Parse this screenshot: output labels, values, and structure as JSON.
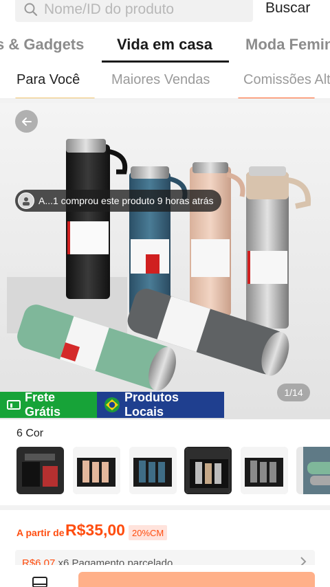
{
  "search": {
    "placeholder": "Nome/ID do produto",
    "button_label": "Buscar"
  },
  "category_tabs": [
    {
      "label": "s & Gadgets",
      "active": false
    },
    {
      "label": "Vida em casa",
      "active": true
    },
    {
      "label": "Moda Femin",
      "active": false
    }
  ],
  "sub_tabs": [
    {
      "label": "Para Você",
      "active": false
    },
    {
      "label": "Maiores Vendas",
      "active": false
    },
    {
      "label": "Comissões Alt",
      "active": true
    }
  ],
  "product": {
    "buyer_notice": "A...1 comprou este produto 9 horas atrás",
    "image_counter": "1/14",
    "badges": {
      "free_shipping": "Frete Grátis",
      "local_products": "Produtos Locais"
    },
    "color_count_label": "6 Cor",
    "price_prefix": "A partir de",
    "price": "R$35,00",
    "commission": "20%CM",
    "installment": {
      "price": "R$6,07",
      "text": "x6 Pagamento parcelado"
    }
  },
  "colors": {
    "accent": "#ff4d0f",
    "free_shipping_green": "#17a338",
    "local_blue": "#1f3f8f",
    "buy_button": "#ffb089"
  },
  "icons": [
    "search-icon",
    "back-arrow-icon",
    "truck-icon",
    "brazil-flag-icon",
    "chevron-right-icon",
    "store-icon"
  ]
}
